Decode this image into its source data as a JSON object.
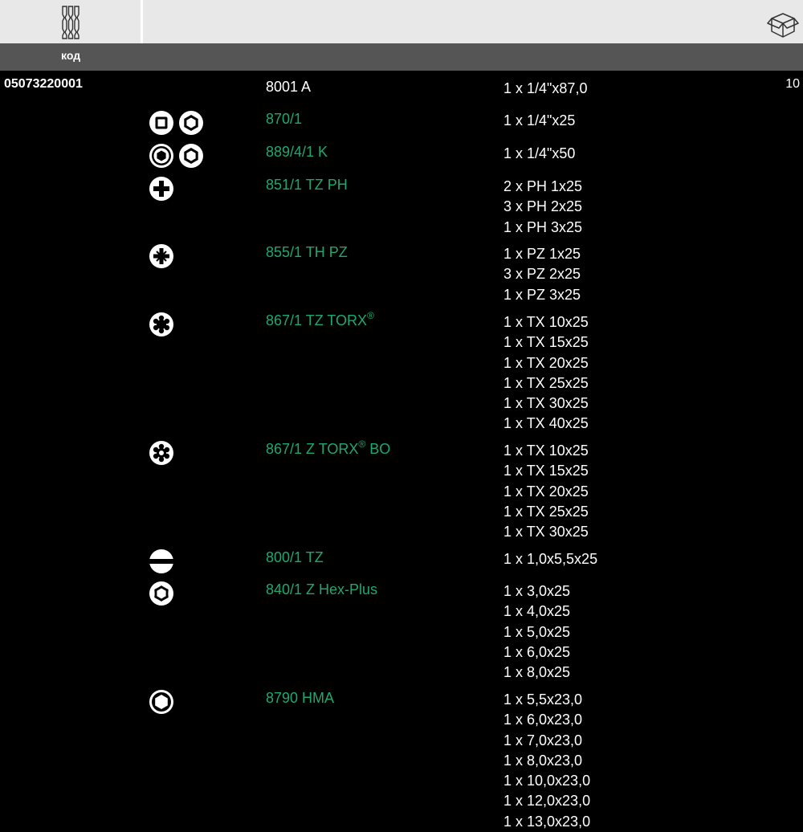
{
  "header": {
    "code_label": "код",
    "tools_icon": "bit-set-icon",
    "box_icon": "package-icon"
  },
  "article": {
    "code": "05073220001",
    "quantity": "10"
  },
  "rows": [
    {
      "name": "8001 A",
      "sizes": [
        "1 x 1/4\"x87,0"
      ]
    },
    {
      "name": "870/1",
      "sizes": [
        "1 x 1/4\"x25"
      ]
    },
    {
      "name": "889/4/1 K",
      "sizes": [
        "1 x 1/4\"x50"
      ]
    },
    {
      "name": "851/1 TZ PH",
      "sizes": [
        "2 x PH 1x25",
        "3 x PH 2x25",
        "1 x PH 3x25"
      ]
    },
    {
      "name": "855/1 TH PZ",
      "sizes": [
        "1 x PZ 1x25",
        "3 x PZ 2x25",
        "1 x PZ 3x25"
      ]
    },
    {
      "name": "867/1 TZ TORX",
      "trademark": "®",
      "sizes": [
        "1 x TX 10x25",
        "1 x TX 15x25",
        "1 x TX 20x25",
        "1 x TX 25x25",
        "1 x TX 30x25",
        "1 x TX 40x25"
      ]
    },
    {
      "name": "867/1 Z TORX",
      "trademark": "®",
      "suffix": " BO",
      "sizes": [
        "1 x TX 10x25",
        "1 x TX 15x25",
        "1 x TX 20x25",
        "1 x TX 25x25",
        "1 x TX 30x25"
      ]
    },
    {
      "name": "800/1 TZ",
      "sizes": [
        "1 x 1,0x5,5x25"
      ]
    },
    {
      "name": "840/1 Z Hex-Plus",
      "sizes": [
        "1 x 3,0x25",
        "1 x 4,0x25",
        "1 x 5,0x25",
        "1 x 6,0x25",
        "1 x 8,0x25"
      ]
    },
    {
      "name": "8790 HMA",
      "sizes": [
        "1 x 5,5x23,0",
        "1 x 6,0x23,0",
        "1 x 7,0x23,0",
        "1 x 8,0x23,0",
        "1 x 10,0x23,0",
        "1 x 12,0x23,0",
        "1 x 13,0x23,0"
      ]
    }
  ],
  "icons": [
    "square-and-hex-drive-icon",
    "hex-nut-and-hex-drive-icon",
    "phillips-icon",
    "pozidriv-icon",
    "torx-icon",
    "torx-tamper-icon",
    "slotted-icon",
    "hex-plus-icon",
    "hex-socket-icon"
  ]
}
